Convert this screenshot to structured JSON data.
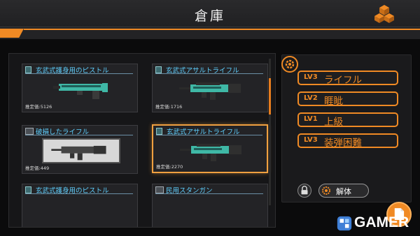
{
  "header": {
    "title": "倉庫"
  },
  "items": [
    {
      "title": "玄武式護身用のピストル",
      "price": "推定価:5126",
      "kind": "pistol",
      "selected": false
    },
    {
      "title": "玄武式アサルトライフル",
      "price": "推定価:1716",
      "kind": "rifle",
      "selected": false
    },
    {
      "title": "破損したライフル",
      "price": "推定価:449",
      "kind": "damaged",
      "selected": false
    },
    {
      "title": "玄武式アサルトライフル",
      "price": "推定価:2270",
      "kind": "rifle",
      "selected": true
    },
    {
      "title": "玄武式護身用のピストル",
      "price": "",
      "kind": "pistol",
      "selected": false
    },
    {
      "title": "民用スタンガン",
      "price": "",
      "kind": "stun",
      "selected": false
    }
  ],
  "stats": [
    {
      "level": "LV3",
      "name": "ライフル"
    },
    {
      "level": "LV2",
      "name": "睚眦"
    },
    {
      "level": "LV1",
      "name": "上級"
    },
    {
      "level": "LV3",
      "name": "装弾困難"
    }
  ],
  "actions": {
    "dismantle_label": "解体"
  },
  "watermark": {
    "text": "GAMER"
  },
  "colors": {
    "accent": "#f08a24",
    "title_text": "#5fd0ff",
    "gun_teal": "#3fb8a6"
  }
}
